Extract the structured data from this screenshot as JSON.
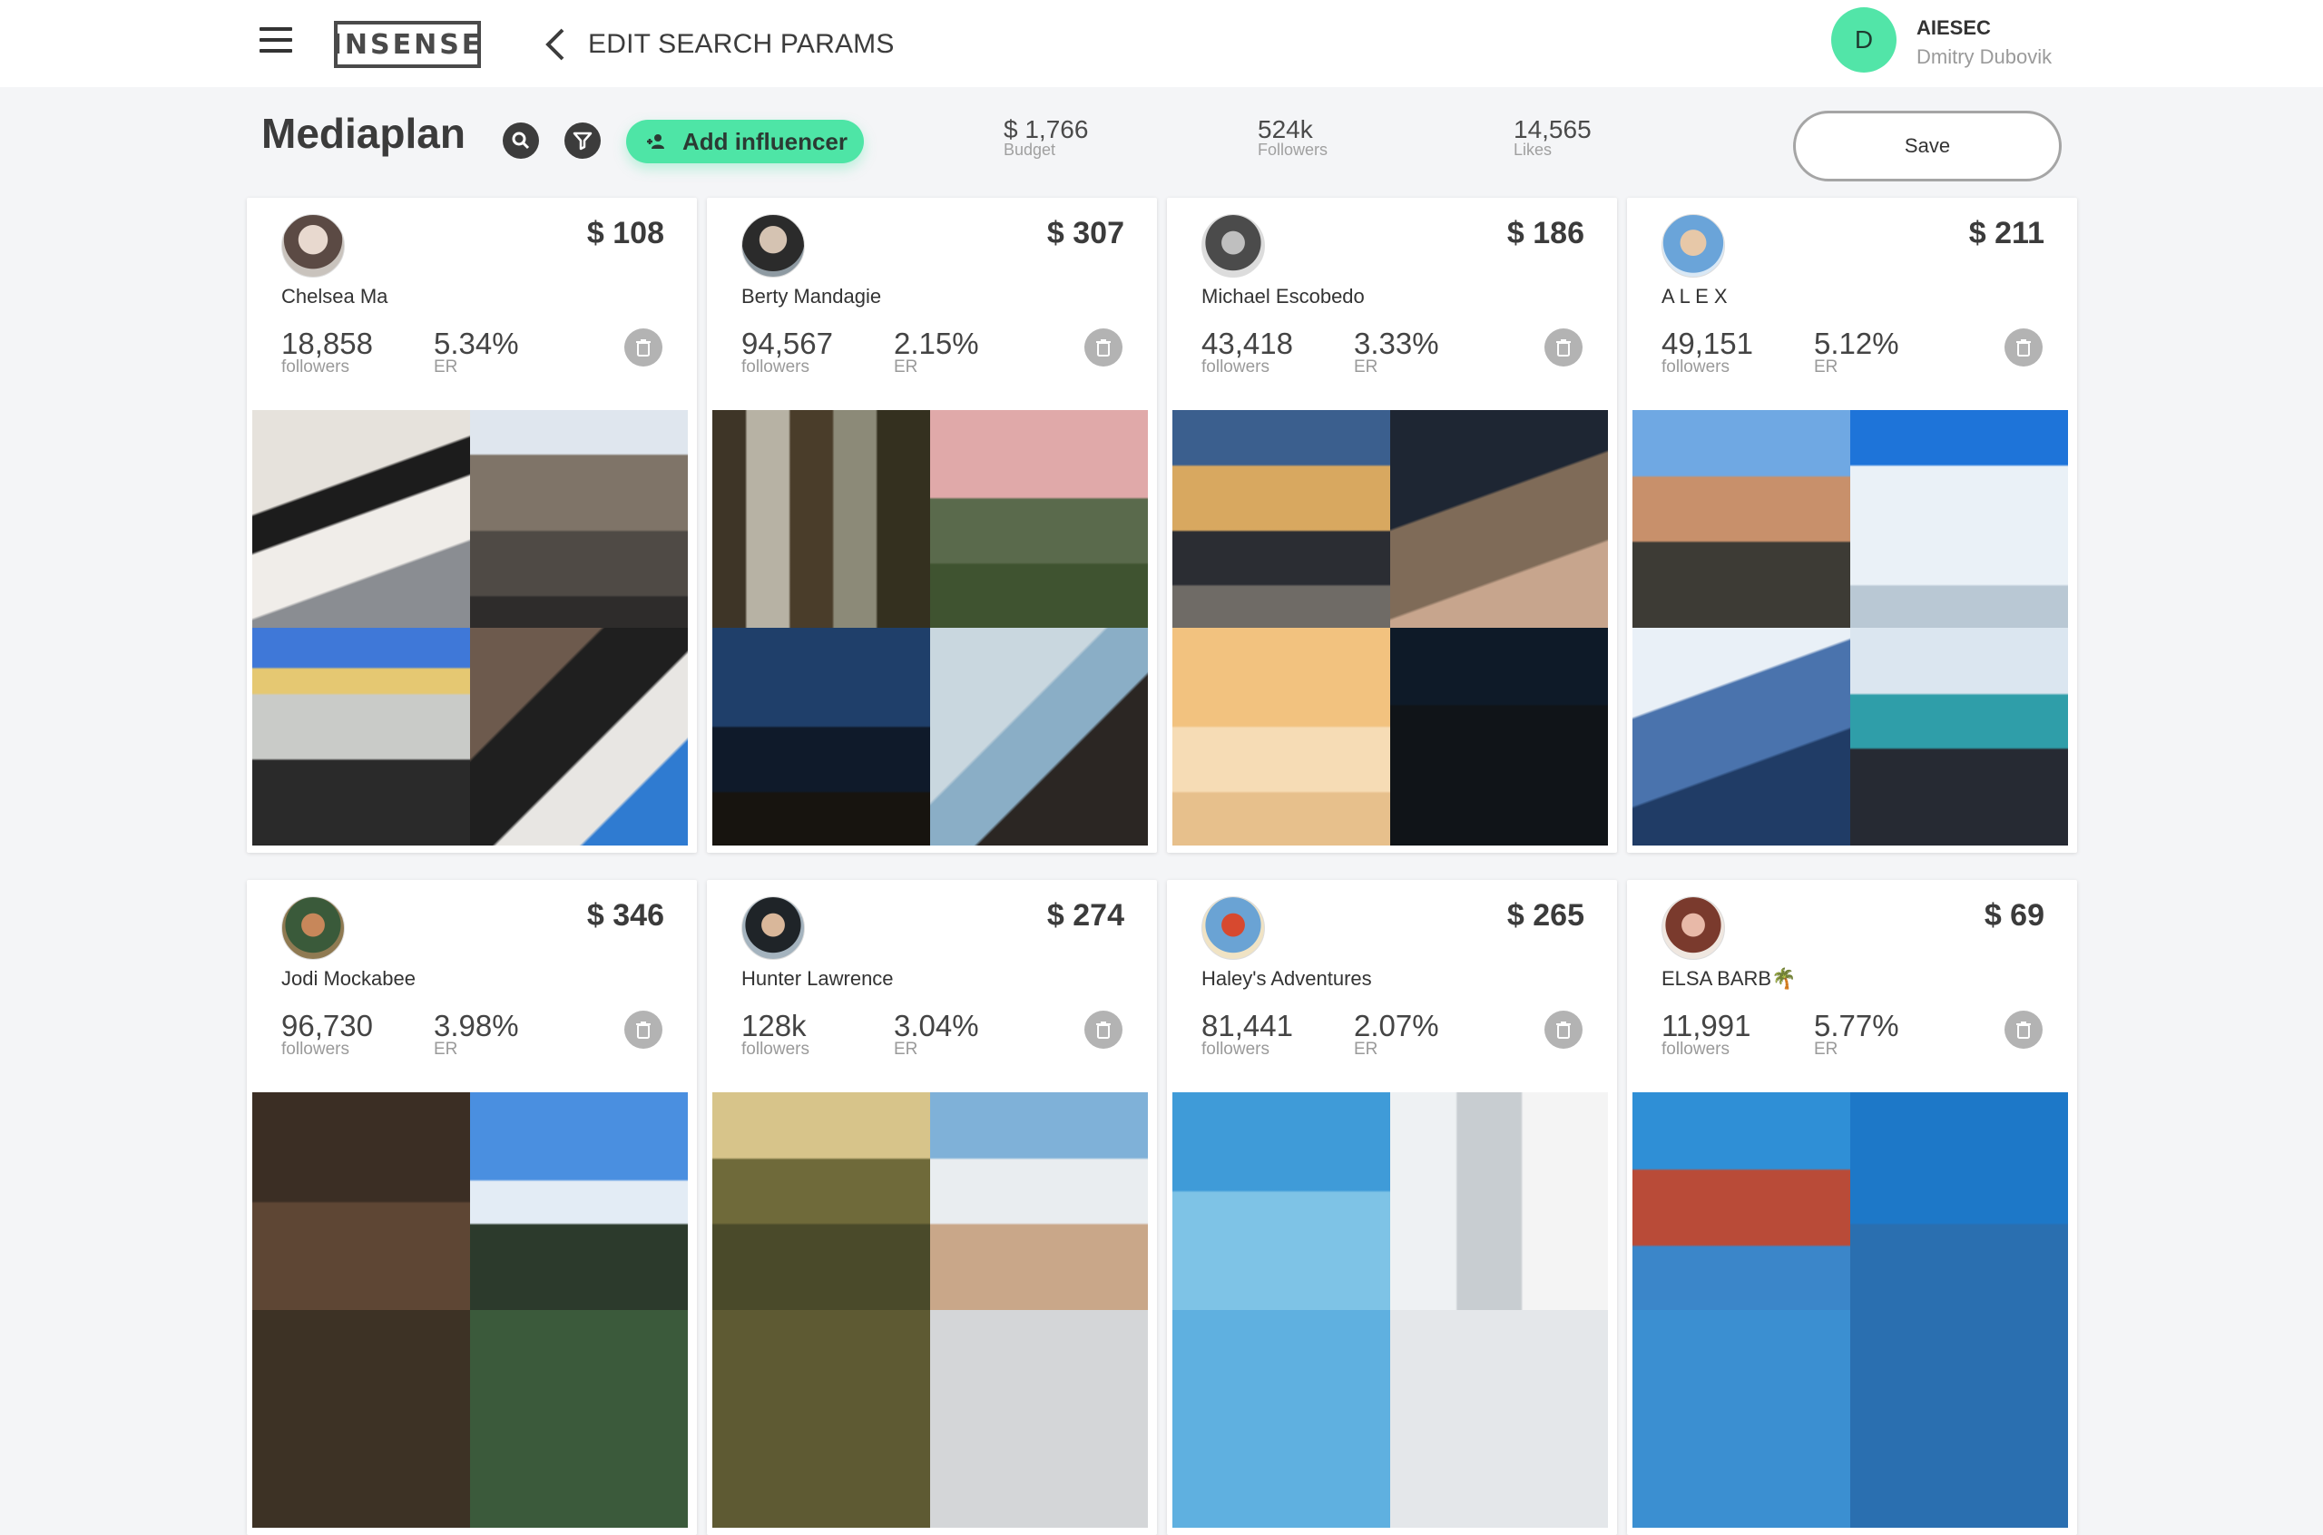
{
  "header": {
    "logo": "INSENSE",
    "back_label": "EDIT SEARCH PARAMS",
    "user_initial": "D",
    "org": "AIESEC",
    "user_name": "Dmitry Dubovik"
  },
  "toolbar": {
    "title": "Mediaplan",
    "add_label": "Add influencer",
    "save_label": "Save",
    "stats": [
      {
        "value": "$ 1,766",
        "label": "Budget"
      },
      {
        "value": "524k",
        "label": "Followers"
      },
      {
        "value": "14,565",
        "label": "Likes"
      }
    ]
  },
  "cards": [
    {
      "name": "Chelsea Ma",
      "price": "$ 108",
      "followers": "18,858",
      "followers_label": "followers",
      "er": "5.34%",
      "er_label": "ER"
    },
    {
      "name": "Berty Mandagie",
      "price": "$ 307",
      "followers": "94,567",
      "followers_label": "followers",
      "er": "2.15%",
      "er_label": "ER"
    },
    {
      "name": "Michael Escobedo",
      "price": "$ 186",
      "followers": "43,418",
      "followers_label": "followers",
      "er": "3.33%",
      "er_label": "ER"
    },
    {
      "name": "A L E X",
      "price": "$ 211",
      "followers": "49,151",
      "followers_label": "followers",
      "er": "5.12%",
      "er_label": "ER"
    },
    {
      "name": "Jodi Mockabee",
      "price": "$ 346",
      "followers": "96,730",
      "followers_label": "followers",
      "er": "3.98%",
      "er_label": "ER"
    },
    {
      "name": "Hunter Lawrence",
      "price": "$ 274",
      "followers": "128k",
      "followers_label": "followers",
      "er": "3.04%",
      "er_label": "ER"
    },
    {
      "name": "Haley's Adventures",
      "price": "$ 265",
      "followers": "81,441",
      "followers_label": "followers",
      "er": "2.07%",
      "er_label": "ER"
    },
    {
      "name": "ELSA BARB🌴",
      "price": "$ 69",
      "followers": "11,991",
      "followers_label": "followers",
      "er": "5.77%",
      "er_label": "ER"
    }
  ],
  "colors": {
    "accent": "#4ee5a6",
    "avatar_bg": "#52e5a8",
    "icon_dark": "#3c3c3c",
    "delete_bg": "#b3b3b3"
  }
}
